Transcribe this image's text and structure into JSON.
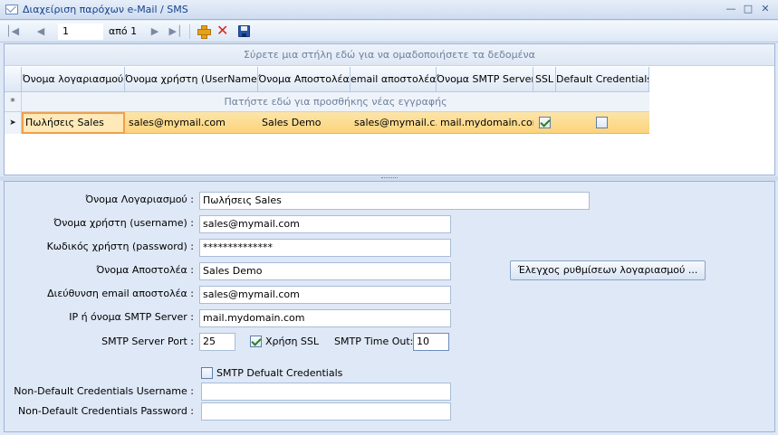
{
  "window": {
    "title": "Διαχείριση παρόχων e-Mail / SMS",
    "icon": "mail-icon"
  },
  "navigator": {
    "position": "1",
    "of_label": "από 1"
  },
  "grid": {
    "group_panel_text": "Σύρετε μια στήλη εδώ για να ομαδοποιήσετε τα δεδομένα",
    "new_row_indicator": "*",
    "new_row_text": "Πατήστε εδώ για προσθήκης νέας εγγραφής",
    "columns": [
      "Όνομα λογαριασμού",
      "Όνομα χρήστη (UserName)",
      "Όνομα Αποστολέα",
      "email αποστολέα",
      "Όνομα SMTP Server",
      "SSL",
      "Default Credentials"
    ],
    "rows": [
      {
        "account": "Πωλήσεις Sales",
        "username": "sales@mymail.com",
        "sender": "Sales Demo",
        "email": "sales@mymail.c...",
        "smtp": "mail.mydomain.com",
        "ssl": true,
        "default_credentials": false
      }
    ]
  },
  "form": {
    "account_label": "Όνομα Λογαριασμού :",
    "account_value": "Πωλήσεις Sales",
    "username_label": "Όνομα χρήστη (username) :",
    "username_value": "sales@mymail.com",
    "password_label": "Κωδικός χρήστη (password) :",
    "password_value": "**************",
    "sender_label": "Όνομα Αποστολέα :",
    "sender_value": "Sales Demo",
    "email_label": "Διεύθυνση email αποστολέα :",
    "email_value": "sales@mymail.com",
    "smtp_label": "IP ή όνομα SMTP Server :",
    "smtp_value": "mail.mydomain.com",
    "port_label": "SMTP Server Port :",
    "port_value": "25",
    "ssl_label": "Χρήση SSL",
    "ssl_checked": true,
    "timeout_label": "SMTP Time Out:",
    "timeout_value": "10",
    "default_cred_label": "SMTP Defualt Credentials",
    "default_cred_checked": false,
    "nd_username_label": "Non-Default Credentials Username :",
    "nd_username_value": "",
    "nd_password_label": "Non-Default Credentials Password :",
    "nd_password_value": "",
    "check_button": "Έλεγχος ρυθμίσεων λογαριασμού ..."
  }
}
